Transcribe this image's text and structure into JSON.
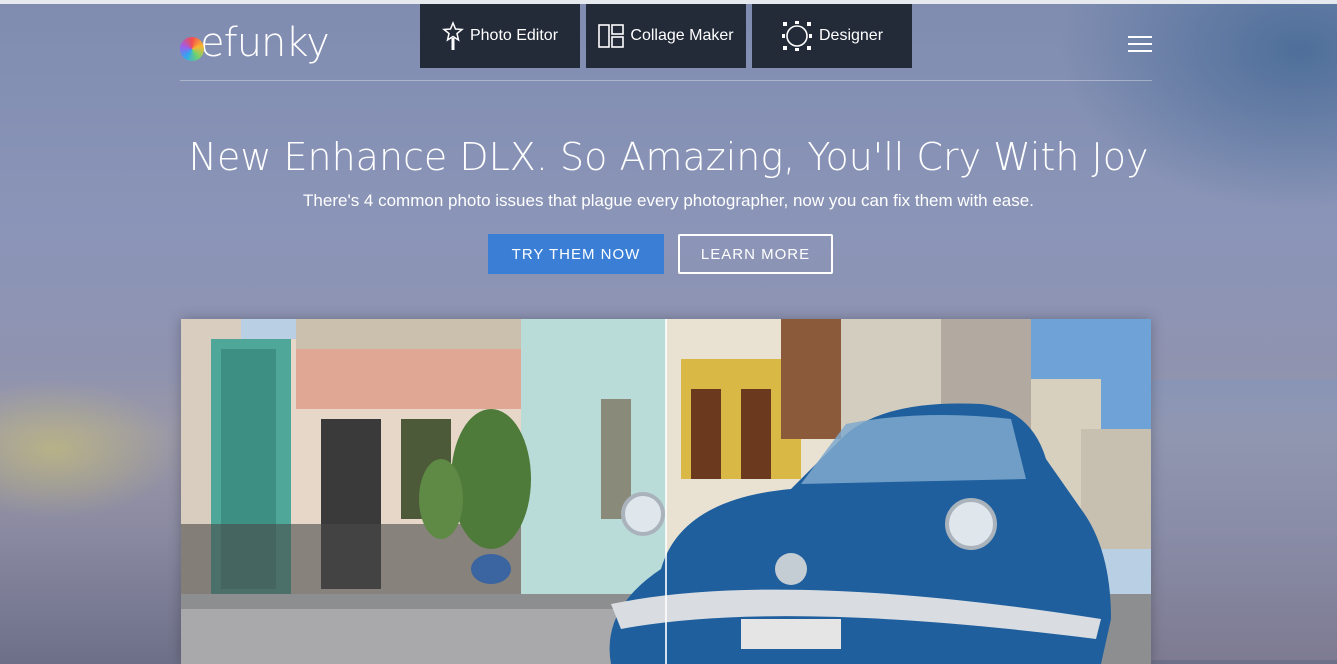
{
  "brand": {
    "logo_text": "efunky",
    "logo_alt": "befunky"
  },
  "nav": {
    "tabs": [
      {
        "label": "Photo Editor",
        "icon": "magic-wand-icon"
      },
      {
        "label": "Collage Maker",
        "icon": "collage-grid-icon"
      },
      {
        "label": "Designer",
        "icon": "designer-circle-icon"
      }
    ],
    "menu_icon": "hamburger-menu-icon"
  },
  "hero": {
    "headline": "New Enhance DLX. So Amazing, You'll Cry With Joy",
    "subhead": "There's 4 common photo issues that plague every photographer, now you can fix them with ease.",
    "primary_button": "TRY THEM NOW",
    "secondary_button": "LEARN MORE"
  },
  "colors": {
    "nav_bg": "#232a38",
    "primary_button": "#3a7fd5",
    "car_blue": "#1f5f9e"
  }
}
